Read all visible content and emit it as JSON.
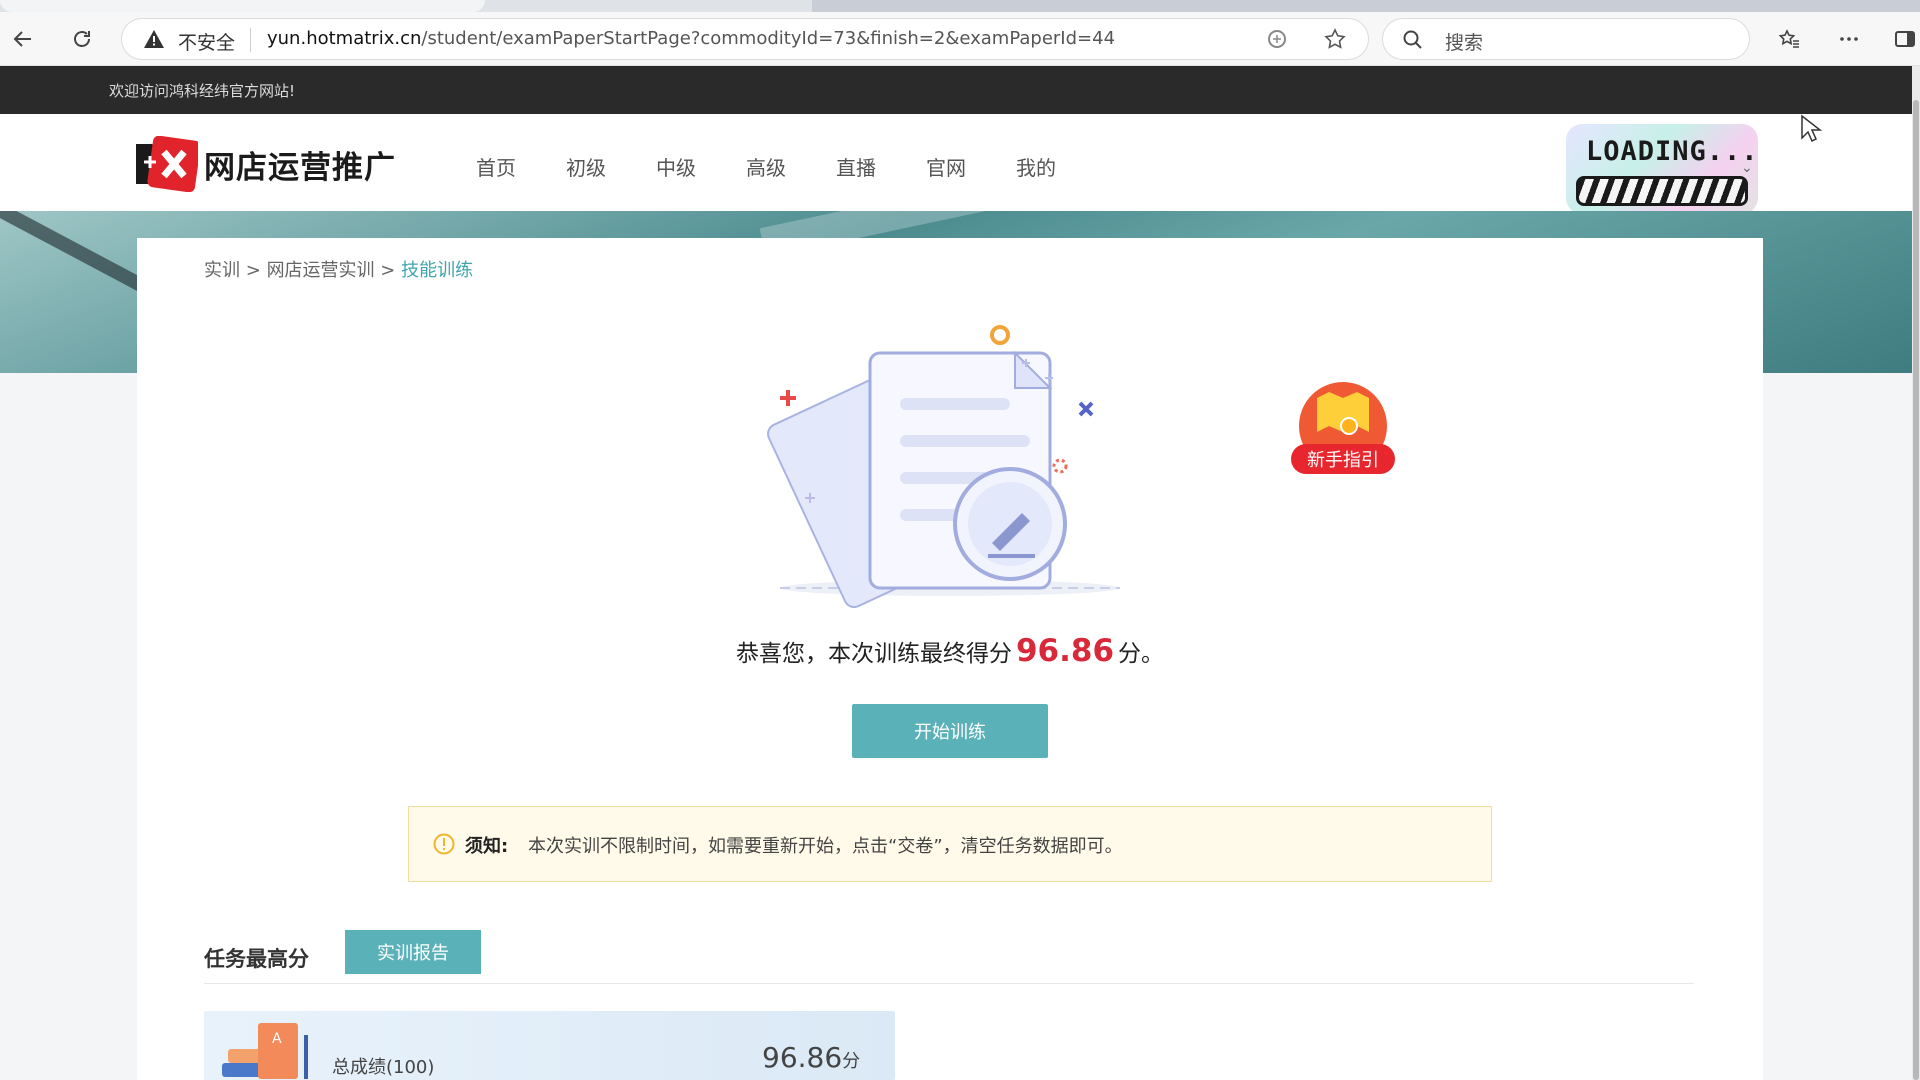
{
  "browser": {
    "address": {
      "security_label": "不安全",
      "url_host": "yun.hotmatrix.cn",
      "url_path": "/student/examPaperStartPage?commodityId=73&finish=2&examPaperId=44"
    },
    "search_placeholder": "搜索",
    "icons": [
      "back-icon",
      "reload-icon",
      "warning-icon",
      "read-aloud-icon",
      "favorite-star-icon",
      "search-icon",
      "favorites-list-icon",
      "more-icon",
      "sidebar-icon"
    ]
  },
  "site": {
    "welcome": "欢迎访问鸿科经纬官方网站!",
    "logo_text": "网店运营推广",
    "nav": [
      {
        "label": "首页"
      },
      {
        "label": "初级"
      },
      {
        "label": "中级"
      },
      {
        "label": "高级"
      },
      {
        "label": "直播"
      },
      {
        "label": "官网"
      },
      {
        "label": "我的"
      }
    ],
    "loading_text": "LOADING..."
  },
  "breadcrumb": {
    "items": [
      "实训",
      "网店运营实训"
    ],
    "separator": ">",
    "current": "技能训练"
  },
  "guide_label": "新手指引",
  "result": {
    "prefix": "恭喜您，本次训练最终得分",
    "score": "96.86",
    "suffix": "分。"
  },
  "start_button": "开始训练",
  "notice": {
    "label": "须知:",
    "text": "本次实训不限制时间，如需要重新开始，点击“交卷”，清空任务数据即可。"
  },
  "task_section": {
    "title": "任务最高分",
    "report_button": "实训报告",
    "total": {
      "label": "总成绩(100)",
      "score": "96.86",
      "unit": "分"
    }
  },
  "colors": {
    "accent": "#5bb1b8",
    "score_red": "#d9283a",
    "breadcrumb_current": "#3fa5ad",
    "notice_bg": "#fffaea"
  }
}
